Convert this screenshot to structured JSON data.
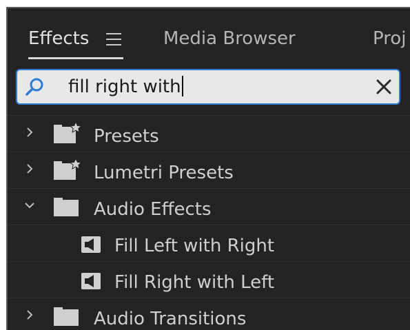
{
  "tabs": [
    {
      "label": "Effects",
      "active": true
    },
    {
      "label": "Media Browser",
      "active": false
    },
    {
      "label": "Proj",
      "active": false
    }
  ],
  "search": {
    "value": "fill right with",
    "icon": "search-icon"
  },
  "tree": [
    {
      "label": "Presets",
      "icon": "preset-folder-icon",
      "expanded": false,
      "level": 0
    },
    {
      "label": "Lumetri Presets",
      "icon": "preset-folder-icon",
      "expanded": false,
      "level": 0
    },
    {
      "label": "Audio Effects",
      "icon": "folder-icon",
      "expanded": true,
      "level": 0
    },
    {
      "label": "Fill Left with Right",
      "icon": "audio-effect-icon",
      "level": 1
    },
    {
      "label": "Fill Right with Left",
      "icon": "audio-effect-icon",
      "level": 1
    },
    {
      "label": "Audio Transitions",
      "icon": "folder-icon",
      "expanded": false,
      "level": 0
    }
  ],
  "colors": {
    "panel_bg": "#232323",
    "focus_accent": "#2f7bd6",
    "text": "#cfcfcf"
  }
}
